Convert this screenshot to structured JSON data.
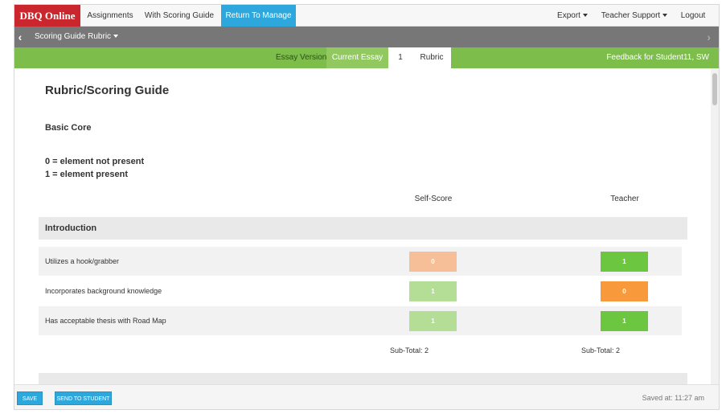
{
  "nav": {
    "brand": "DBQ Online",
    "assignments": "Assignments",
    "with_scoring_guide": "With Scoring Guide",
    "return_to_manage": "Return To Manage",
    "export": "Export",
    "teacher_support": "Teacher Support",
    "logout": "Logout"
  },
  "subbar": {
    "title": "Scoring Guide Rubric"
  },
  "essay_bar": {
    "label": "Essay Version:",
    "current": "Current Essay",
    "version_number": "1",
    "rubric_tab": "Rubric",
    "feedback": "Feedback for Student11, SW"
  },
  "rubric": {
    "title": "Rubric/Scoring Guide",
    "subtitle": "Basic Core",
    "legend": [
      "0 = element not present",
      "1 = element present"
    ],
    "columns": {
      "self": "Self-Score",
      "teacher": "Teacher"
    },
    "sections": [
      {
        "name": "Introduction",
        "rows": [
          {
            "label": "Utilizes a hook/grabber",
            "self": "0",
            "teacher": "1"
          },
          {
            "label": "Incorporates background knowledge",
            "self": "1",
            "teacher": "0"
          },
          {
            "label": "Has acceptable thesis with Road Map",
            "self": "1",
            "teacher": "1"
          }
        ],
        "subtotal_self": "Sub-Total: 2",
        "subtotal_teacher": "Sub-Total: 2"
      }
    ]
  },
  "colors": {
    "self_zero": "#f6bf98",
    "self_one": "#b4dd96",
    "teacher_zero": "#f89a3c",
    "teacher_one": "#6cc63f"
  },
  "footer": {
    "save": "SAVE",
    "send": "SEND TO STUDENT",
    "saved_at": "Saved at: 11:27 am"
  }
}
